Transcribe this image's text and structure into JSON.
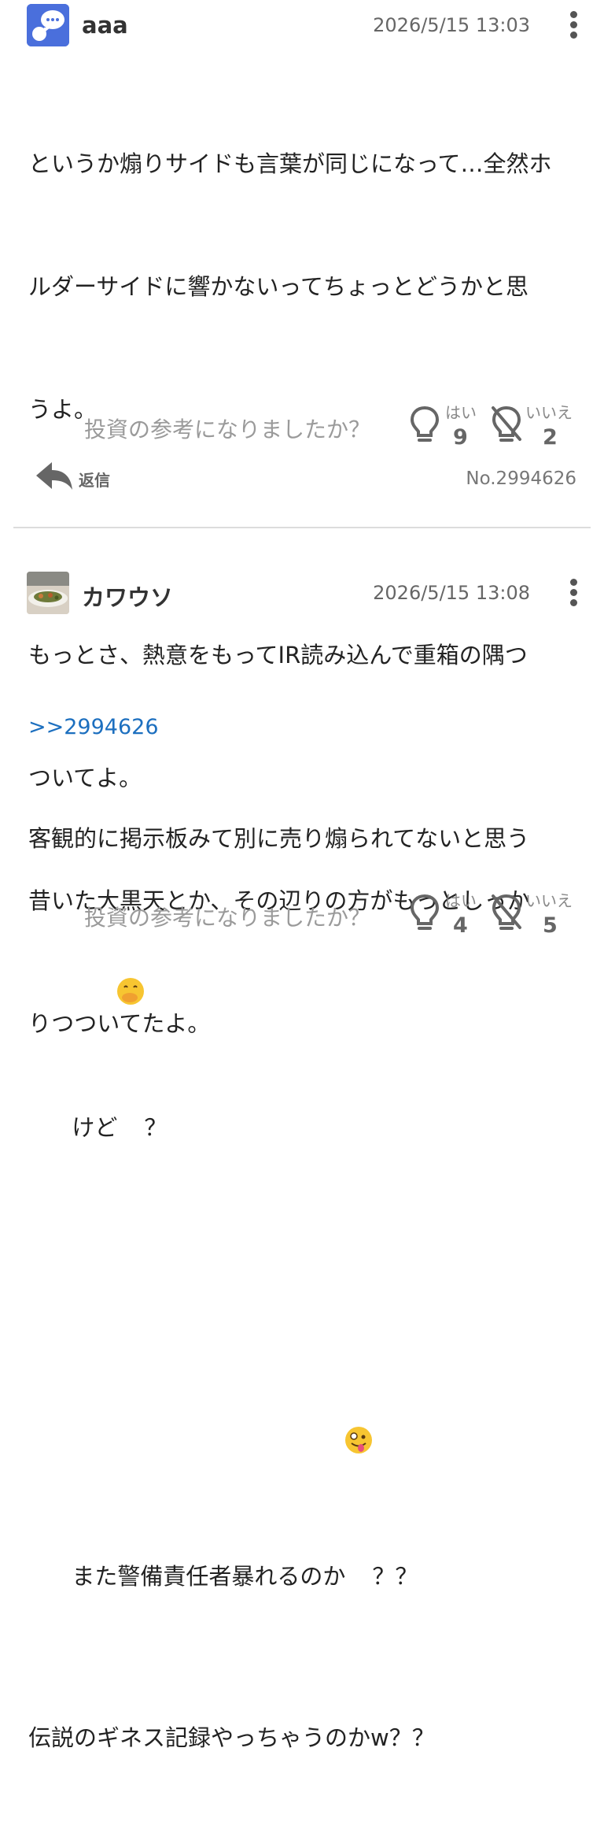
{
  "posts": [
    {
      "username": "aaa",
      "timestamp": "2026/5/15 13:03",
      "avatar_icon": "speech-bubble-icon",
      "avatar_color": "#4a6fdc",
      "body_lines": [
        "というか煽りサイドも言葉が同じになって…全然ホ",
        "ルダーサイドに響かないってちょっとどうかと思",
        "うよ。",
        "",
        "もっとさ、熱意をもってIR読み込んで重箱の隅つ",
        "ついてよ。",
        "昔いた大黒天とか、その辺りの方がもっとしっか",
        "りつついてたよ。"
      ],
      "vote_question": "投資の参考になりましたか？",
      "yes_label": "はい",
      "yes_count": "9",
      "no_label": "いいえ",
      "no_count": "2",
      "reply_label": "返信",
      "post_number": "No.2994626"
    },
    {
      "username": "カワウソ",
      "timestamp": "2026/5/15 13:08",
      "avatar_icon": "food-photo-icon",
      "reply_to": ">>2994626",
      "body_line1": "客観的に掲示板みて別に売り煽られてないと思う",
      "body_line2_a": "けど",
      "emoji1": "face-with-hand-over-mouth-icon",
      "body_line2_b": "？",
      "body_line3_a": "また警備責任者暴れるのか",
      "emoji2": "zany-face-icon",
      "body_line3_b": "？？",
      "body_line4": "伝説のギネス記録やっちゃうのかw？？",
      "vote_question": "投資の参考になりましたか？",
      "yes_label": "はい",
      "yes_count": "4",
      "no_label": "いいえ",
      "no_count": "5"
    }
  ],
  "colors": {
    "link": "#1c6fbf",
    "icon_gray": "#666666",
    "divider": "#dcdcdc"
  }
}
